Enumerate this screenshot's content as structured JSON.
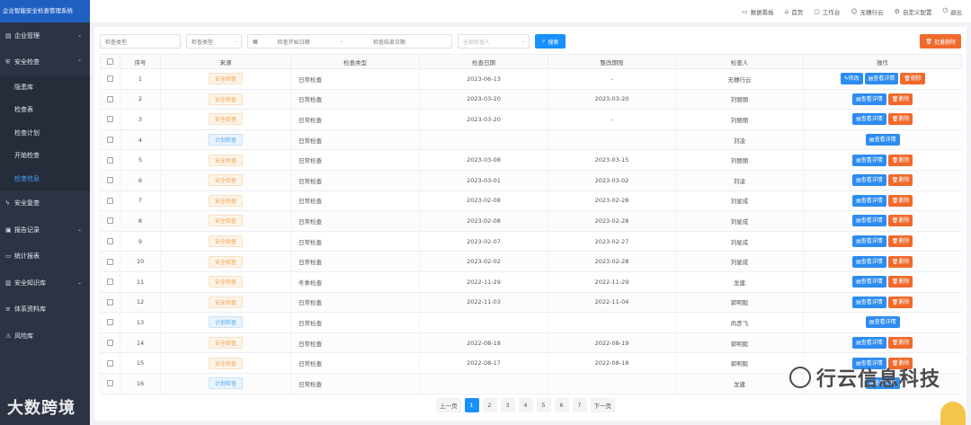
{
  "app": {
    "title": "企业智能安全检查管理系统"
  },
  "sidebar": {
    "items": [
      {
        "label": "企业管理",
        "icon": "building-icon",
        "arrow": "⌄"
      },
      {
        "label": "安全检查",
        "icon": "shield-icon",
        "arrow": "⌃"
      },
      {
        "label": "隐患库",
        "sub": true
      },
      {
        "label": "检查表",
        "sub": true
      },
      {
        "label": "检查计划",
        "sub": true
      },
      {
        "label": "开始检查",
        "sub": true
      },
      {
        "label": "检查信息",
        "sub": true,
        "active": true
      },
      {
        "label": "安全复查",
        "icon": "bolt-icon",
        "arrow": ""
      },
      {
        "label": "报告记录",
        "icon": "report-icon",
        "arrow": "⌄"
      },
      {
        "label": "统计报表",
        "icon": "folder-icon",
        "arrow": ""
      },
      {
        "label": "安全知识库",
        "icon": "book-icon",
        "arrow": "⌄"
      },
      {
        "label": "体系资料库",
        "icon": "layers-icon",
        "arrow": ""
      },
      {
        "label": "风险库",
        "icon": "warning-icon",
        "arrow": ""
      }
    ],
    "watermark": "大数跨境"
  },
  "topbar": {
    "items": [
      {
        "label": "数据看板",
        "icon": "monitor-icon"
      },
      {
        "label": "首页",
        "icon": "home-icon"
      },
      {
        "label": "工作台",
        "icon": "desktop-icon"
      },
      {
        "label": "无穗行云",
        "icon": "user-icon"
      },
      {
        "label": "自定义配置",
        "icon": "gear-icon"
      },
      {
        "label": "退出",
        "icon": "power-icon"
      }
    ]
  },
  "filters": {
    "type_input": "检查类型",
    "type_select": "检查类型",
    "date_start": "检查开始日期",
    "date_sep": "-",
    "date_end": "检查结束日期",
    "inspector_select": "全部检查人",
    "search_label": "搜索",
    "batch_delete_label": "批量删除"
  },
  "table": {
    "columns": [
      "序号",
      "来源",
      "检查类型",
      "检查日期",
      "整改期限",
      "检查人",
      "操作"
    ],
    "ops": {
      "edit": "修改",
      "detail": "查看详情",
      "delete": "删除"
    },
    "rows": [
      {
        "no": "1",
        "source": "安全检查",
        "type": "日常检查",
        "date": "2023-06-13",
        "deadline": "-",
        "inspector": "无穗行云",
        "ops": "edit-detail-delete"
      },
      {
        "no": "2",
        "source": "安全检查",
        "type": "日常检查",
        "date": "2023-03-20",
        "deadline": "2023-03-20",
        "inspector": "刘丽丽",
        "ops": "detail-delete"
      },
      {
        "no": "3",
        "source": "安全检查",
        "type": "日常检查",
        "date": "2023-03-20",
        "deadline": "-",
        "inspector": "刘丽丽",
        "ops": "detail-delete"
      },
      {
        "no": "4",
        "source": "计划检查",
        "type": "日常检查",
        "date": "",
        "deadline": "",
        "inspector": "刘凌",
        "ops": "detail"
      },
      {
        "no": "5",
        "source": "安全检查",
        "type": "日常检查",
        "date": "2023-03-08",
        "deadline": "2023-03-15",
        "inspector": "刘丽丽",
        "ops": "detail-delete"
      },
      {
        "no": "6",
        "source": "安全检查",
        "type": "日常检查",
        "date": "2023-03-01",
        "deadline": "2023-03-02",
        "inspector": "刘凌",
        "ops": "detail-delete"
      },
      {
        "no": "7",
        "source": "安全检查",
        "type": "日常检查",
        "date": "2023-02-08",
        "deadline": "2023-02-28",
        "inspector": "刘星成",
        "ops": "detail-delete"
      },
      {
        "no": "8",
        "source": "安全检查",
        "type": "日常检查",
        "date": "2023-02-08",
        "deadline": "2023-02-28",
        "inspector": "刘星成",
        "ops": "detail-delete"
      },
      {
        "no": "9",
        "source": "安全检查",
        "type": "日常检查",
        "date": "2023-02-07",
        "deadline": "2023-02-27",
        "inspector": "刘星成",
        "ops": "detail-delete"
      },
      {
        "no": "10",
        "source": "安全检查",
        "type": "日常检查",
        "date": "2023-02-02",
        "deadline": "2023-02-28",
        "inspector": "刘星成",
        "ops": "detail-delete"
      },
      {
        "no": "11",
        "source": "安全检查",
        "type": "冬季检查",
        "date": "2022-11-29",
        "deadline": "2022-11-29",
        "inspector": "龙建",
        "ops": "detail-delete"
      },
      {
        "no": "12",
        "source": "安全检查",
        "type": "日常检查",
        "date": "2022-11-03",
        "deadline": "2022-11-04",
        "inspector": "郭明毅",
        "ops": "detail-delete"
      },
      {
        "no": "13",
        "source": "计划检查",
        "type": "日常检查",
        "date": "",
        "deadline": "",
        "inspector": "尚彦飞",
        "ops": "detail"
      },
      {
        "no": "14",
        "source": "安全检查",
        "type": "日常检查",
        "date": "2022-08-18",
        "deadline": "2022-08-19",
        "inspector": "郭明毅",
        "ops": "detail-delete"
      },
      {
        "no": "15",
        "source": "安全检查",
        "type": "日常检查",
        "date": "2022-08-17",
        "deadline": "2022-08-18",
        "inspector": "郭明毅",
        "ops": "detail-delete"
      },
      {
        "no": "16",
        "source": "计划检查",
        "type": "日常检查",
        "date": "",
        "deadline": "",
        "inspector": "龙建",
        "ops": "detail"
      }
    ]
  },
  "pager": {
    "prev": "上一页",
    "pages": [
      "1",
      "2",
      "3",
      "4",
      "5",
      "6",
      "7"
    ],
    "active": "1",
    "next": "下一页"
  },
  "watermark_right": "行云信息科技",
  "colors": {
    "primary": "#1890ff",
    "danger": "#f06a2c",
    "sidebar": "#2c3444",
    "brand": "#1f5fc2"
  }
}
